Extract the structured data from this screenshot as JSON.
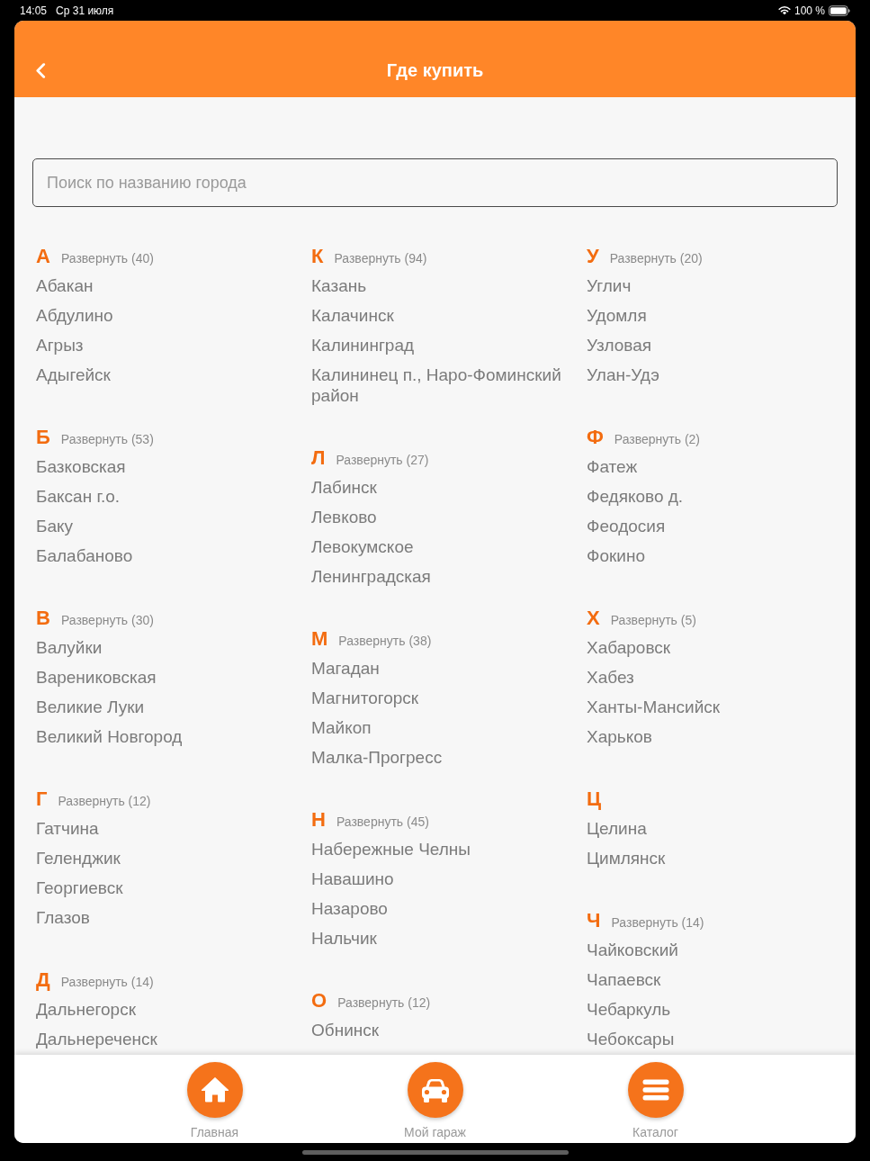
{
  "status_bar": {
    "time": "14:05",
    "date": "Ср 31 июля",
    "battery": "100 %"
  },
  "header": {
    "title": "Где купить"
  },
  "search": {
    "placeholder": "Поиск по названию города"
  },
  "columns": [
    {
      "groups": [
        {
          "letter": "А",
          "expand": "Развернуть (40)",
          "cities": [
            "Абакан",
            "Абдулино",
            "Агрыз",
            "Адыгейск"
          ]
        },
        {
          "letter": "Б",
          "expand": "Развернуть (53)",
          "cities": [
            "Базковская",
            "Баксан г.о.",
            "Баку",
            "Балабаново"
          ]
        },
        {
          "letter": "В",
          "expand": "Развернуть (30)",
          "cities": [
            "Валуйки",
            "Варениковская",
            "Великие Луки",
            "Великий Новгород"
          ]
        },
        {
          "letter": "Г",
          "expand": "Развернуть (12)",
          "cities": [
            "Гатчина",
            "Геленджик",
            "Георгиевск",
            "Глазов"
          ]
        },
        {
          "letter": "Д",
          "expand": "Развернуть (14)",
          "cities": [
            "Дальнегорск",
            "Дальнереченск"
          ]
        }
      ]
    },
    {
      "groups": [
        {
          "letter": "К",
          "expand": "Развернуть (94)",
          "cities": [
            "Казань",
            "Калачинск",
            "Калининград",
            "Калининец п., Наро-Фоминский район"
          ]
        },
        {
          "letter": "Л",
          "expand": "Развернуть (27)",
          "cities": [
            "Лабинск",
            "Левково",
            "Левокумское",
            "Ленинградская"
          ]
        },
        {
          "letter": "М",
          "expand": "Развернуть (38)",
          "cities": [
            "Магадан",
            "Магнитогорск",
            "Майкоп",
            "Малка-Прогресс"
          ]
        },
        {
          "letter": "Н",
          "expand": "Развернуть (45)",
          "cities": [
            "Набережные Челны",
            "Навашино",
            "Назарово",
            "Нальчик"
          ]
        },
        {
          "letter": "О",
          "expand": "Развернуть (12)",
          "cities": [
            "Обнинск"
          ]
        }
      ]
    },
    {
      "groups": [
        {
          "letter": "У",
          "expand": "Развернуть (20)",
          "cities": [
            "Углич",
            "Удомля",
            "Узловая",
            "Улан-Удэ"
          ]
        },
        {
          "letter": "Ф",
          "expand": "Развернуть (2)",
          "cities": [
            "Фатеж",
            "Федяково д.",
            "Феодосия",
            "Фокино"
          ]
        },
        {
          "letter": "Х",
          "expand": "Развернуть (5)",
          "cities": [
            "Хабаровск",
            "Хабез",
            "Ханты-Мансийск",
            "Харьков"
          ]
        },
        {
          "letter": "Ц",
          "cities": [
            "Целина",
            "Цимлянск"
          ]
        },
        {
          "letter": "Ч",
          "expand": "Развернуть (14)",
          "cities": [
            "Чайковский",
            "Чапаевск",
            "Чебаркуль",
            "Чебоксары"
          ]
        }
      ]
    }
  ],
  "tab_bar": [
    {
      "kind": "home",
      "label": "Главная"
    },
    {
      "kind": "car",
      "label": "Мой гараж"
    },
    {
      "kind": "menu",
      "label": "Каталог"
    }
  ]
}
